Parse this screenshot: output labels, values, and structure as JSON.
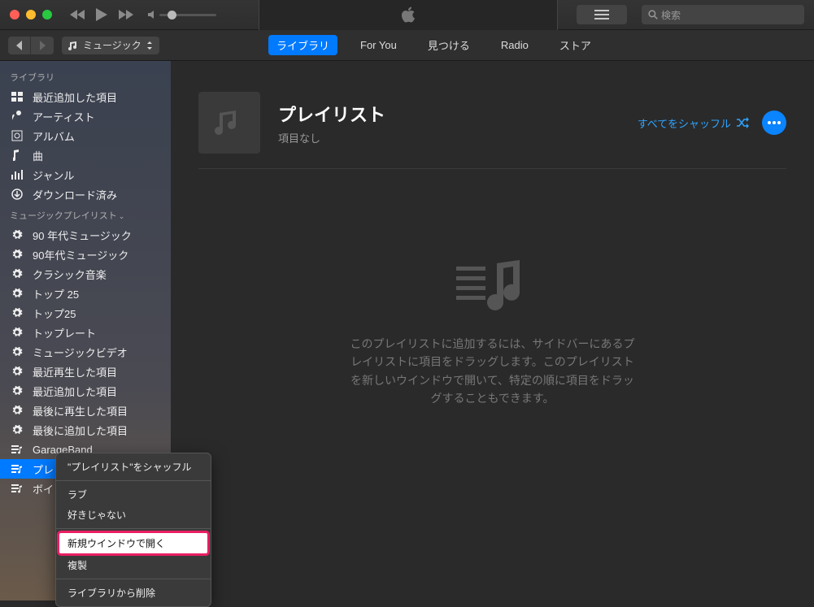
{
  "search": {
    "placeholder": "検索"
  },
  "mediaSelector": {
    "label": "ミュージック"
  },
  "navTabs": [
    {
      "label": "ライブラリ",
      "active": true
    },
    {
      "label": "For You",
      "active": false
    },
    {
      "label": "見つける",
      "active": false
    },
    {
      "label": "Radio",
      "active": false
    },
    {
      "label": "ストア",
      "active": false
    }
  ],
  "sidebar": {
    "sections": [
      {
        "title": "ライブラリ",
        "items": [
          {
            "icon": "grid",
            "label": "最近追加した項目"
          },
          {
            "icon": "mic",
            "label": "アーティスト"
          },
          {
            "icon": "album",
            "label": "アルバム"
          },
          {
            "icon": "note",
            "label": "曲"
          },
          {
            "icon": "bars",
            "label": "ジャンル"
          },
          {
            "icon": "download",
            "label": "ダウンロード済み"
          }
        ]
      },
      {
        "title": "ミュージックプレイリスト",
        "expandable": true,
        "items": [
          {
            "icon": "gear",
            "label": "90 年代ミュージック"
          },
          {
            "icon": "gear",
            "label": "90年代ミュージック"
          },
          {
            "icon": "gear",
            "label": "クラシック音楽"
          },
          {
            "icon": "gear",
            "label": "トップ 25"
          },
          {
            "icon": "gear",
            "label": "トップ25"
          },
          {
            "icon": "gear",
            "label": "トップレート"
          },
          {
            "icon": "gear",
            "label": "ミュージックビデオ"
          },
          {
            "icon": "gear",
            "label": "最近再生した項目"
          },
          {
            "icon": "gear",
            "label": "最近追加した項目"
          },
          {
            "icon": "gear",
            "label": "最後に再生した項目"
          },
          {
            "icon": "gear",
            "label": "最後に追加した項目"
          },
          {
            "icon": "playlist",
            "label": "GarageBand"
          },
          {
            "icon": "playlist",
            "label": "プレ",
            "selected": true
          },
          {
            "icon": "playlist",
            "label": "ボイ"
          }
        ]
      }
    ]
  },
  "main": {
    "title": "プレイリスト",
    "subtitle": "項目なし",
    "shuffle_label": "すべてをシャッフル",
    "empty_message": "このプレイリストに追加するには、サイドバーにあるプレイリストに項目をドラッグします。このプレイリストを新しいウインドウで開いて、特定の順に項目をドラッグすることもできます。"
  },
  "contextMenu": {
    "items": [
      {
        "label": "\"プレイリスト\"をシャッフル"
      },
      {
        "sep": true
      },
      {
        "label": "ラブ"
      },
      {
        "label": "好きじゃない"
      },
      {
        "sep": true
      },
      {
        "label": "新規ウインドウで開く",
        "highlight": true
      },
      {
        "label": "複製"
      },
      {
        "sep": true
      },
      {
        "label": "ライブラリから削除"
      }
    ]
  }
}
